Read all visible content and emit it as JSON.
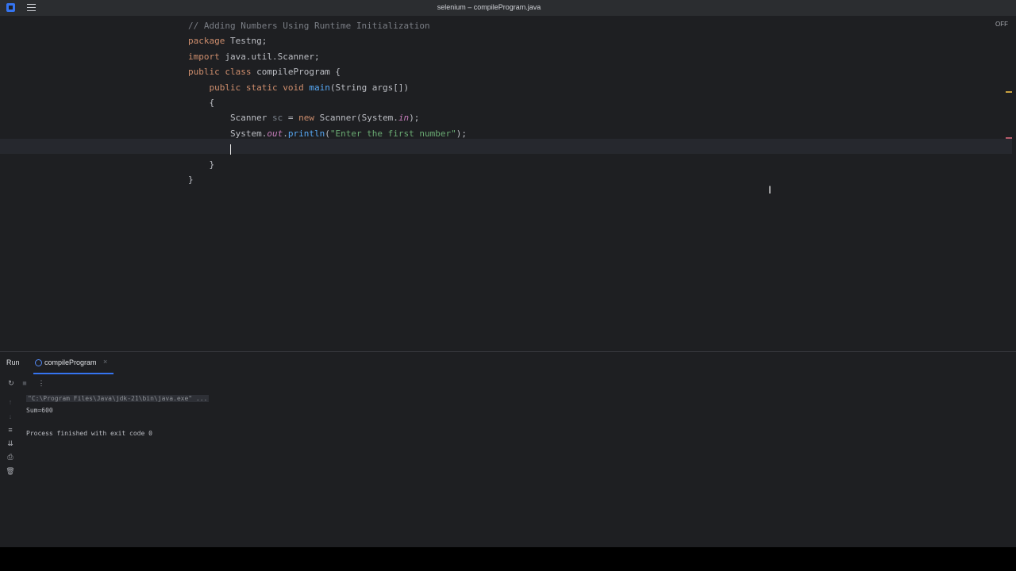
{
  "window": {
    "title": "selenium – compileProgram.java"
  },
  "editor": {
    "off_label": "OFF",
    "lines": [
      [
        {
          "t": "// Adding Numbers Using Runtime Initialization",
          "c": "cm"
        }
      ],
      [
        {
          "t": "package ",
          "c": "kw"
        },
        {
          "t": "Testng;",
          "c": ""
        }
      ],
      [
        {
          "t": "import ",
          "c": "kw"
        },
        {
          "t": "java.util.Scanner;",
          "c": ""
        }
      ],
      [
        {
          "t": "public class ",
          "c": "kw"
        },
        {
          "t": "compileProgram {",
          "c": ""
        }
      ],
      [
        {
          "t": "    public static void ",
          "c": "kw"
        },
        {
          "t": "main",
          "c": "fn"
        },
        {
          "t": "(String args[])",
          "c": ""
        }
      ],
      [
        {
          "t": "    {",
          "c": ""
        }
      ],
      [
        {
          "t": "        Scanner ",
          "c": ""
        },
        {
          "t": "sc",
          "c": "vr"
        },
        {
          "t": " = ",
          "c": ""
        },
        {
          "t": "new ",
          "c": "kw"
        },
        {
          "t": "Scanner(System.",
          "c": ""
        },
        {
          "t": "in",
          "c": "it"
        },
        {
          "t": ");",
          "c": ""
        }
      ],
      [
        {
          "t": "        System.",
          "c": ""
        },
        {
          "t": "out",
          "c": "it"
        },
        {
          "t": ".",
          "c": ""
        },
        {
          "t": "println",
          "c": "fn"
        },
        {
          "t": "(",
          "c": ""
        },
        {
          "t": "\"Enter the first number\"",
          "c": "st"
        },
        {
          "t": ");",
          "c": ""
        }
      ],
      [
        {
          "t": "        ",
          "c": ""
        },
        {
          "t": "|",
          "c": "caret"
        }
      ],
      [
        {
          "t": "    }",
          "c": ""
        }
      ],
      [
        {
          "t": "}",
          "c": ""
        }
      ]
    ]
  },
  "run_panel": {
    "label": "Run",
    "tab_label": "compileProgram",
    "console_lines": [
      {
        "t": "\"C:\\Program Files\\Java\\jdk-21\\bin\\java.exe\" ...",
        "c": "cmdline"
      },
      {
        "t": "Sum=600",
        "c": ""
      },
      {
        "t": "",
        "c": ""
      },
      {
        "t": "Process finished with exit code 0",
        "c": ""
      }
    ]
  },
  "icons": [
    "app-logo-icon",
    "menu-icon",
    "rerun-icon",
    "stop-icon",
    "more-icon",
    "up-arrow-icon",
    "down-arrow-icon",
    "wrap-icon",
    "scroll-to-end-icon",
    "print-icon",
    "trash-icon",
    "close-icon",
    "text-cursor-icon"
  ]
}
